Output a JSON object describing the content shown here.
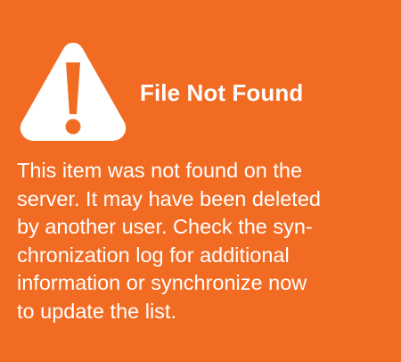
{
  "dialog": {
    "background_color": "#f26b22",
    "text_color": "#ffffff",
    "icon": "warning-triangle-icon",
    "title": "File Not Found",
    "message_lines": [
      "This item was not found on the",
      "server. It may have been deleted",
      "by another user. Check the syn-",
      "chronization log for additional",
      "information or synchronize now",
      "to update the list."
    ]
  }
}
